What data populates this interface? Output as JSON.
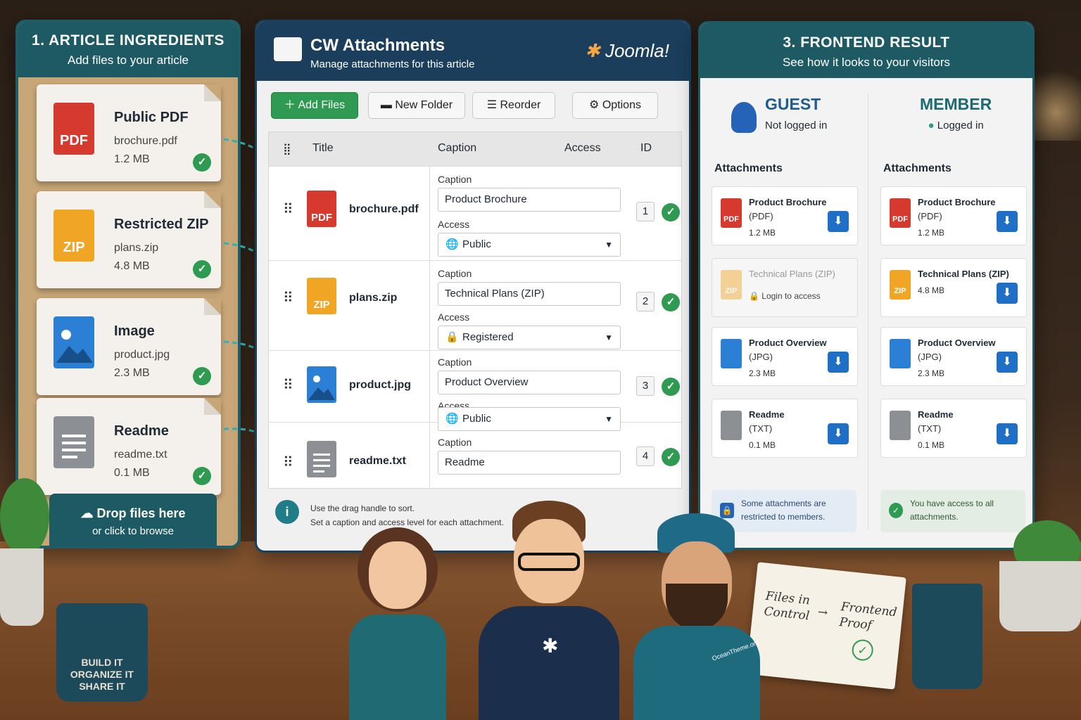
{
  "panel1": {
    "title": "1. ARTICLE INGREDIENTS",
    "subtitle": "Add files to your article",
    "cards": [
      {
        "name": "Public PDF",
        "file": "brochure.pdf",
        "size": "1.2 MB",
        "icon_label": "PDF"
      },
      {
        "name": "Restricted ZIP",
        "file": "plans.zip",
        "size": "4.8 MB",
        "icon_label": "ZIP"
      },
      {
        "name": "Image",
        "file": "product.jpg",
        "size": "2.3 MB",
        "icon_label": ""
      },
      {
        "name": "Readme",
        "file": "readme.txt",
        "size": "0.1 MB",
        "icon_label": ""
      }
    ],
    "drop_title": "Drop files here",
    "drop_sub": "or click to browse"
  },
  "panel2": {
    "title": "CW Attachments",
    "subtitle": "Manage attachments for this article",
    "logo_text": "Joomla!",
    "toolbar": {
      "add": "Add Files",
      "folder": "New Folder",
      "reorder": "Reorder",
      "options": "Options"
    },
    "headers": {
      "title": "Title",
      "caption": "Caption",
      "access": "Access",
      "id": "ID"
    },
    "rows": [
      {
        "file": "brochure.pdf",
        "caption_label": "Caption",
        "caption": "Product Brochure",
        "access_label": "Access",
        "access": "Public",
        "id": "1",
        "icon_label": "PDF"
      },
      {
        "file": "plans.zip",
        "caption_label": "Caption",
        "caption": "Technical Plans (ZIP)",
        "access_label": "Access",
        "access": "Registered",
        "id": "2",
        "icon_label": "ZIP"
      },
      {
        "file": "product.jpg",
        "caption_label": "Caption",
        "caption": "Product Overview",
        "access_label": "Access",
        "access": "Public",
        "id": "3",
        "icon_label": ""
      },
      {
        "file": "readme.txt",
        "caption_label": "Caption",
        "caption": "Readme",
        "id": "4",
        "icon_label": ""
      }
    ],
    "info_line1": "Use the drag handle to sort.",
    "info_line2": "Set a caption and access level for each attachment."
  },
  "panel3": {
    "title": "3. FRONTEND RESULT",
    "subtitle": "See how it looks to your visitors",
    "guest": {
      "label": "GUEST",
      "status": "Not logged in",
      "heading": "Attachments",
      "items": [
        {
          "title": "Product Brochure",
          "type": "(PDF)",
          "size": "1.2 MB",
          "icon_label": "PDF"
        },
        {
          "title": "Technical Plans (ZIP)",
          "type": "Login to access",
          "size": "",
          "icon_label": "ZIP"
        },
        {
          "title": "Product Overview",
          "type": "(JPG)",
          "size": "2.3 MB",
          "icon_label": ""
        },
        {
          "title": "Readme",
          "type": "(TXT)",
          "size": "0.1 MB",
          "icon_label": ""
        }
      ],
      "note": "Some attachments are restricted to members."
    },
    "member": {
      "label": "MEMBER",
      "status": "Logged in",
      "heading": "Attachments",
      "items": [
        {
          "title": "Product Brochure",
          "type": "(PDF)",
          "size": "1.2 MB",
          "icon_label": "PDF"
        },
        {
          "title": "Technical Plans (ZIP)",
          "type": "4.8 MB",
          "size": "",
          "icon_label": "ZIP"
        },
        {
          "title": "Product Overview",
          "type": "(JPG)",
          "size": "2.3 MB",
          "icon_label": ""
        },
        {
          "title": "Readme",
          "type": "(TXT)",
          "size": "0.1 MB",
          "icon_label": ""
        }
      ],
      "note": "You have access to all attachments."
    }
  },
  "desk": {
    "mug_l1": "BUILD IT",
    "mug_l2": "ORGANIZE IT",
    "mug_l3": "SHARE IT",
    "notepad_a": "Files in Control",
    "notepad_b": "Frontend Proof",
    "shirt": "OceanTheme.org"
  },
  "colors": {
    "teal": "#1d5a63",
    "navy": "#1a3e5c",
    "green": "#2e9a52",
    "blue": "#1f6fc7"
  }
}
